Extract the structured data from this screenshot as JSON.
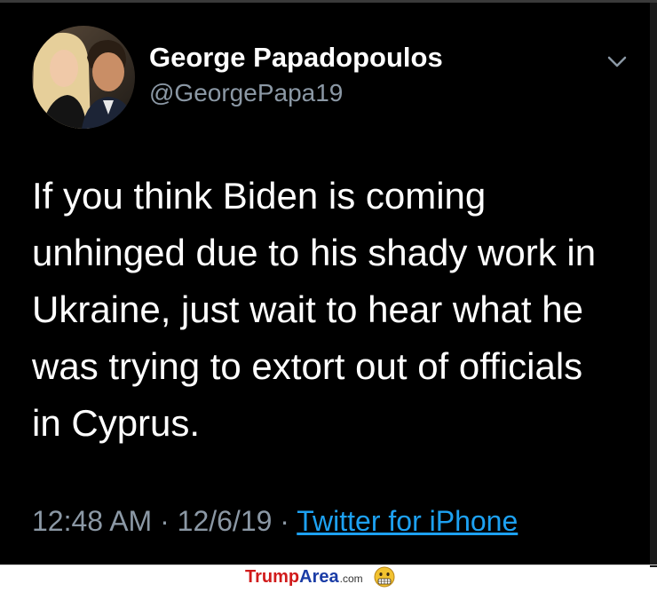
{
  "tweet": {
    "display_name": "George Papadopoulos",
    "handle": "@GeorgePapa19",
    "text": "If you think Biden is coming\nunhinged due to his shady work in\nUkraine, just wait to hear what he\nwas trying to extort out of officials\nin Cyprus.",
    "time": "12:48 AM",
    "separator": "·",
    "date": "12/6/19",
    "source": "Twitter for iPhone",
    "menu_icon": "chevron-down-icon"
  },
  "watermark": {
    "word1": "Trump",
    "word2": "Area",
    "suffix": ".com",
    "icon": "grimace-emoji-icon"
  },
  "colors": {
    "background": "#000000",
    "text": "#ffffff",
    "secondary": "#8b98a5",
    "link": "#1da1f2"
  }
}
